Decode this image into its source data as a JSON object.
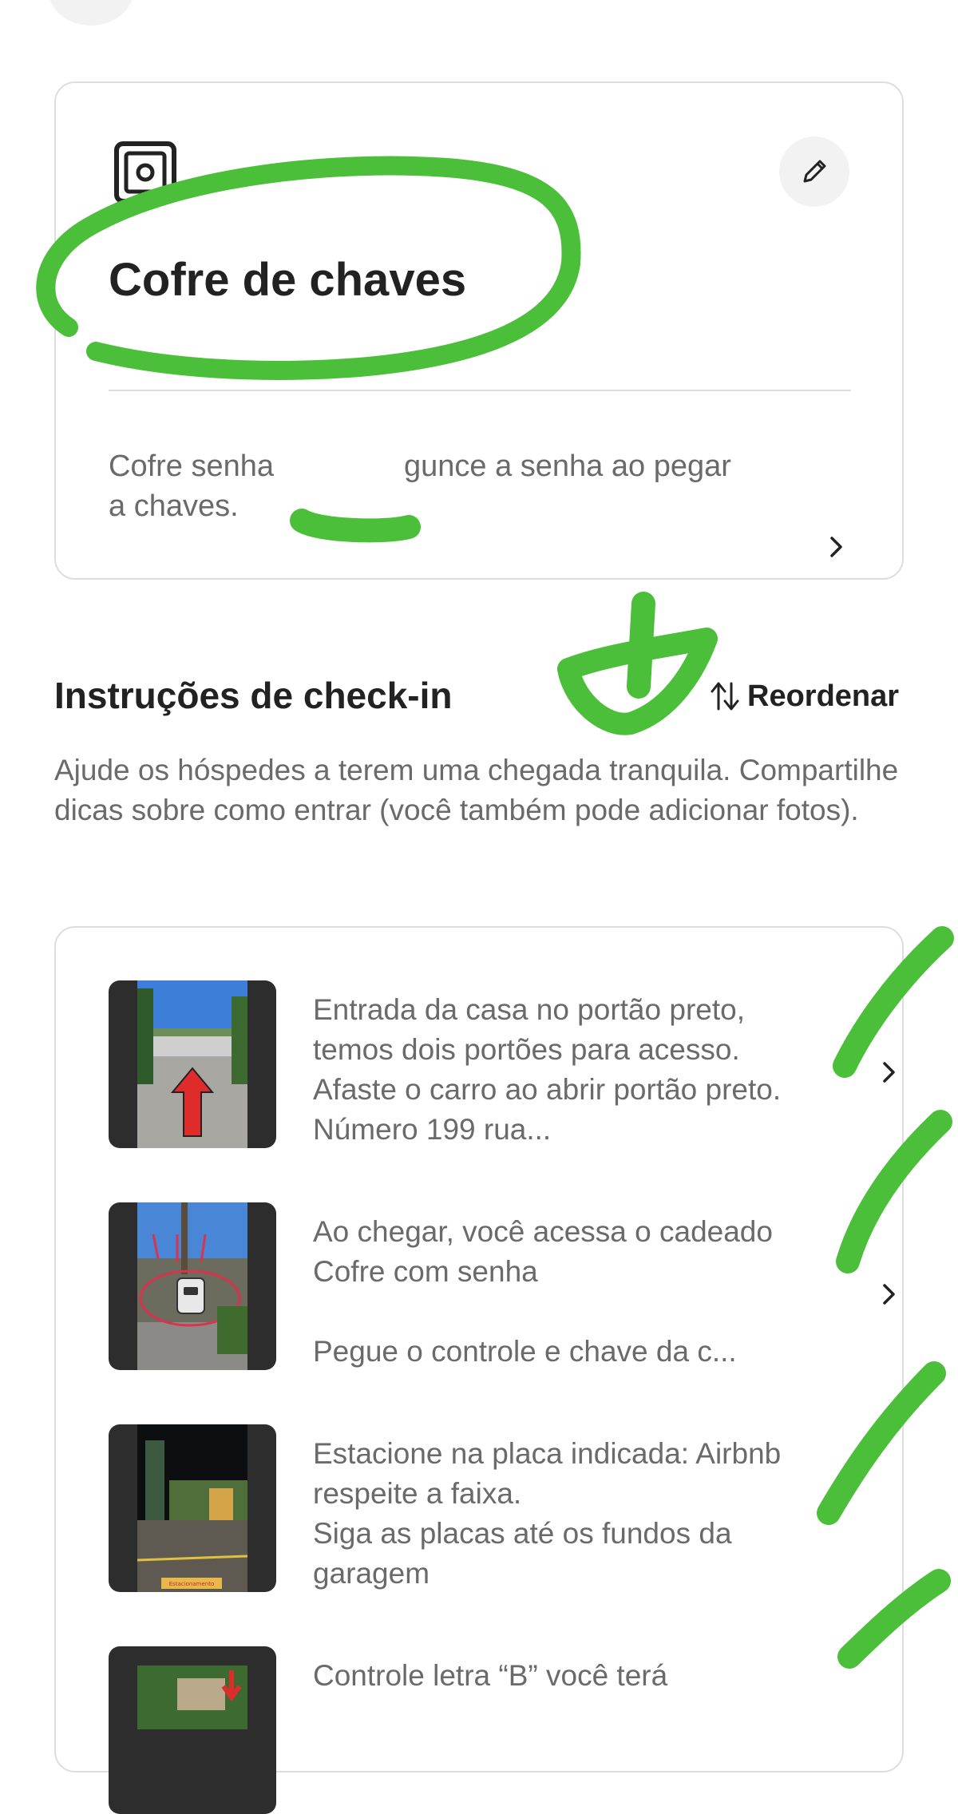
{
  "lockbox": {
    "title": "Cofre de chaves",
    "description_a": "Cofre senha\na chaves.",
    "description_b": "gunce a senha ao pegar",
    "icon": "safe-icon",
    "edit_icon": "pencil-icon"
  },
  "checkin": {
    "title": "Instruções de check-in",
    "reorder_label": "Reordenar",
    "description": "Ajude os hóspedes a terem uma chegada tranquila. Compartilhe dicas sobre como entrar (você também pode adicionar fotos).",
    "steps": [
      {
        "text": "Entrada da casa no portão preto, temos dois portões para acesso. Afaste o carro ao abrir portão preto. Número 199 rua..."
      },
      {
        "text": "Ao chegar, você acessa o cadeado Cofre com senha\n\nPegue o controle e chave da c..."
      },
      {
        "text": "Estacione na placa indicada: Airbnb respeite a faixa.\nSiga as placas até os fundos da garagem",
        "photo_label": "Estacionamento"
      },
      {
        "text": "Controle letra “B” você terá"
      }
    ]
  },
  "colors": {
    "annotation": "#4cbf3a",
    "text_primary": "#222222",
    "text_secondary": "#6a6a6a",
    "border": "#dddddd"
  }
}
